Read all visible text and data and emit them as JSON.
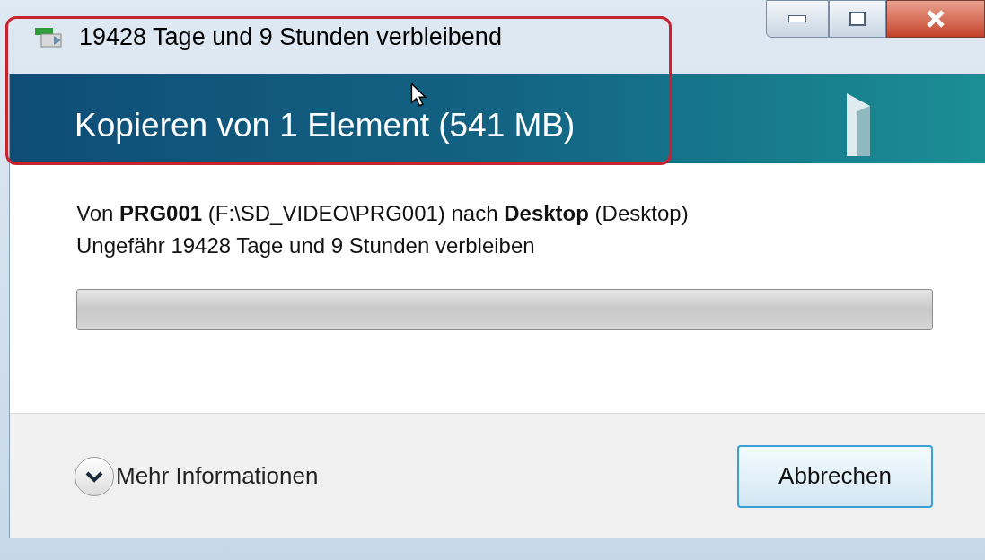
{
  "window": {
    "title": "19428 Tage und 9 Stunden verbleibend"
  },
  "header": {
    "title": "Kopieren von 1 Element (541 MB)"
  },
  "description": "Von **PRG001** (F:\\SD_VIDEO\\PRG001) nach **Desktop** (Desktop)",
  "time_remaining": "Ungefähr 19428 Tage und 9 Stunden verbleiben",
  "progress": {
    "level": 0
  },
  "more_info": {
    "label": "Mehr Informationen",
    "expanded": false
  },
  "buttons": [
    {
      "label": "Abbrechen",
      "default": true
    }
  ]
}
